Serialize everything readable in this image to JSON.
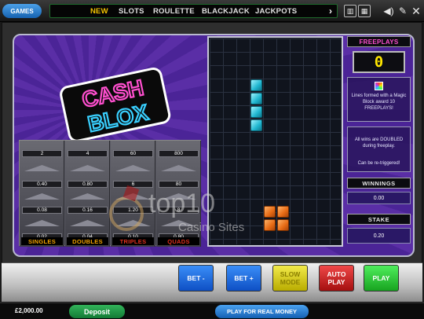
{
  "topbar": {
    "games_label": "GAMES",
    "nav": [
      "NEW",
      "SLOTS",
      "ROULETTE",
      "BLACKJACK",
      "JACKPOTS"
    ],
    "icons": [
      "chevron-right-icon",
      "layout-icon",
      "grid-icon",
      "speaker-icon",
      "wrench-icon",
      "close-icon"
    ]
  },
  "logo": {
    "line1": "CASH",
    "line2": "BLOX"
  },
  "paytable": {
    "columns": [
      {
        "label": "SINGLES",
        "color": "#f2a200",
        "values": [
          "2",
          "0.40",
          "0.08",
          "0.02"
        ]
      },
      {
        "label": "DOUBLES",
        "color": "#f2a200",
        "values": [
          "4",
          "0.80",
          "0.16",
          "0.04"
        ]
      },
      {
        "label": "TRIPLES",
        "color": "#e0301e",
        "values": [
          "60",
          "6",
          "1.20",
          "0.10"
        ]
      },
      {
        "label": "QUADS",
        "color": "#e0301e",
        "values": [
          "800",
          "80",
          "8",
          "0.80"
        ]
      }
    ]
  },
  "freeplays": {
    "title": "FREEPLAYS",
    "count": "0",
    "info": "Lines formed with a Magic Block award 10 FREEPLAYS!",
    "doubled": "All wins are DOUBLED during freeplay.",
    "retrigger": "Can be re-triggered!"
  },
  "winnings": {
    "label": "WINNINGS",
    "value": "0.00"
  },
  "stake": {
    "label": "STAKE",
    "value": "0.20"
  },
  "controls": {
    "bet_minus": "BET -",
    "bet_plus": "BET +",
    "slow_mode": "SLOW MODE",
    "auto_play": "AUTO PLAY",
    "play": "PLAY"
  },
  "bottom": {
    "balance": "£2,000.00",
    "deposit": "Deposit",
    "real_money": "PLAY FOR REAL MONEY"
  },
  "watermark": {
    "brand": "top10",
    "sub": "Casino Sites"
  },
  "colors": {
    "cyan_block": "#1fb5cf",
    "orange_block": "#e66a14",
    "panel_purple": "#4b2497"
  }
}
